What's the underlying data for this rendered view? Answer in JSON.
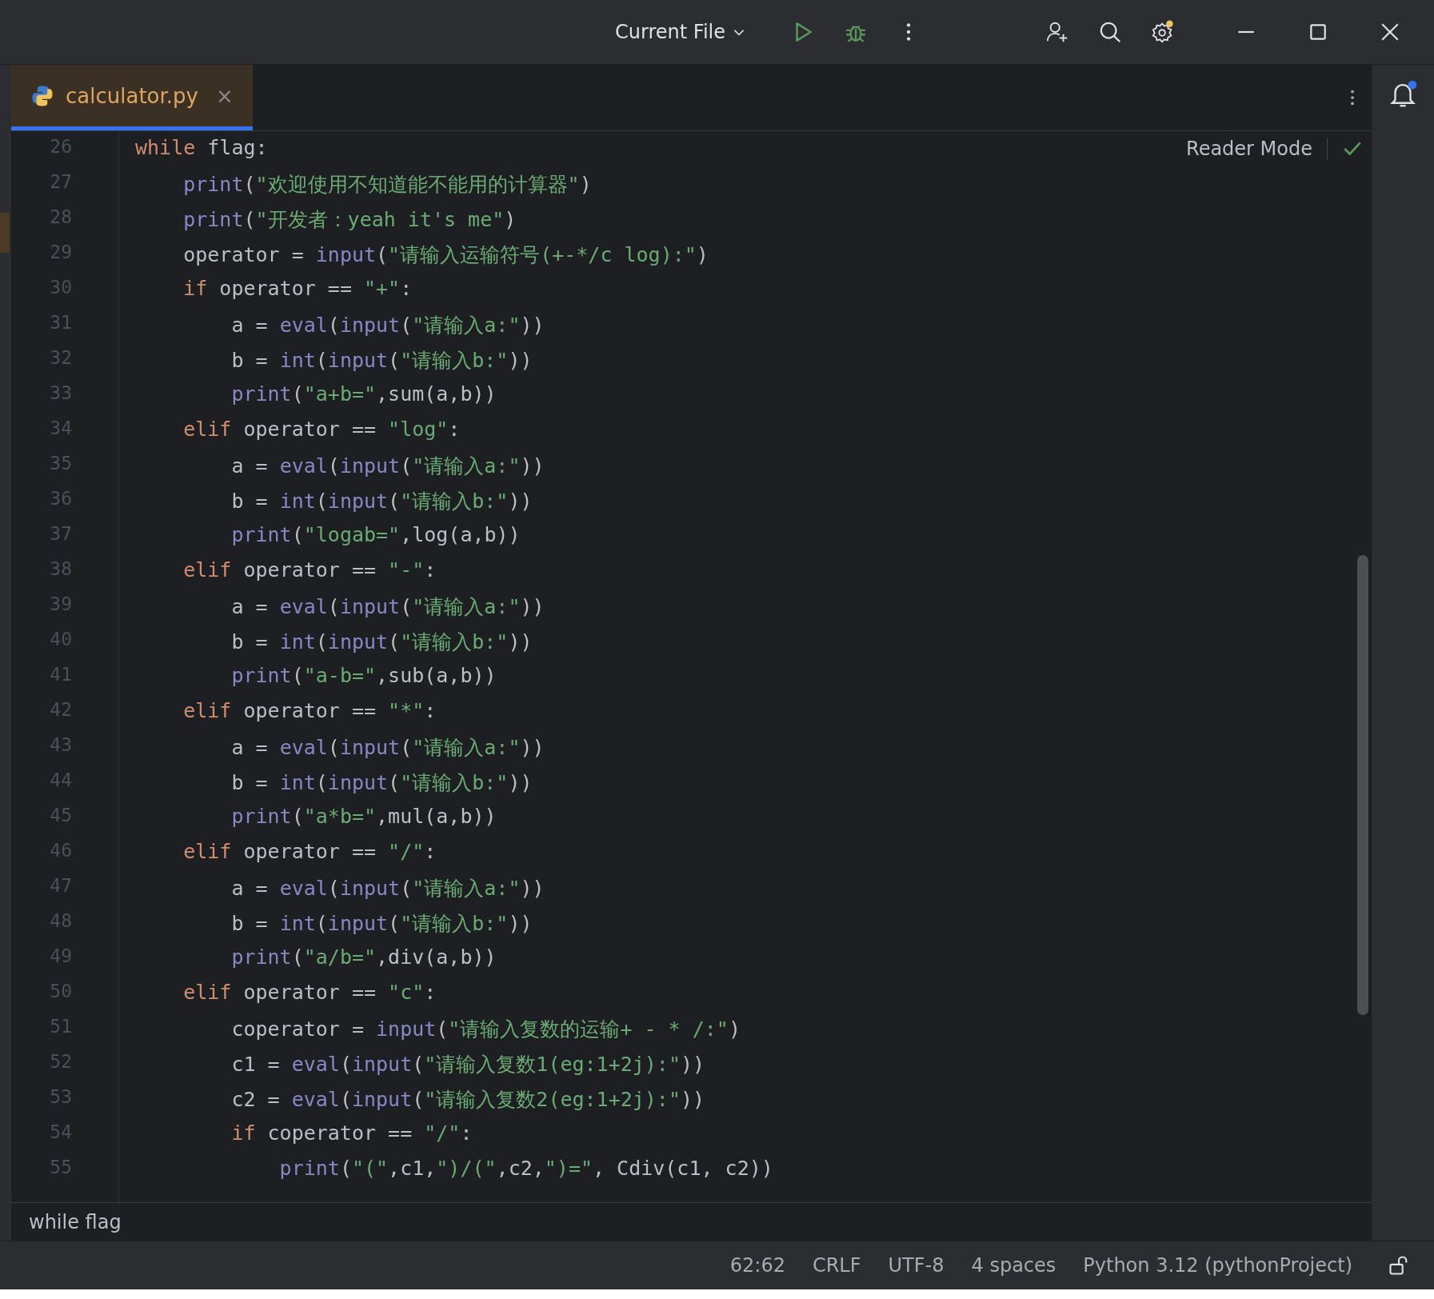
{
  "toolbar": {
    "run_configuration": "Current File"
  },
  "tabs": [
    {
      "label": "calculator.py",
      "selected": true,
      "close": "×"
    }
  ],
  "reader_mode": {
    "label": "Reader Mode"
  },
  "code_lines": [
    {
      "number": "26",
      "tokens": [
        {
          "kind": "kw",
          "text": "while"
        },
        {
          "kind": "plain",
          "text": " flag:"
        }
      ],
      "children": [
        {
          "number": "27",
          "tokens": [
            {
              "kind": "fn",
              "text": "print"
            },
            {
              "kind": "plain",
              "text": "("
            },
            {
              "kind": "str",
              "text": "\"欢迎使用不知道能不能用的计算器\""
            },
            {
              "kind": "plain",
              "text": ")"
            }
          ]
        },
        {
          "number": "28",
          "tokens": [
            {
              "kind": "fn",
              "text": "print"
            },
            {
              "kind": "plain",
              "text": "("
            },
            {
              "kind": "str",
              "text": "\"开发者：yeah it's me\""
            },
            {
              "kind": "plain",
              "text": ")"
            }
          ]
        },
        {
          "number": "29",
          "tokens": [
            {
              "kind": "plain",
              "text": "operator = "
            },
            {
              "kind": "fn",
              "text": "input"
            },
            {
              "kind": "plain",
              "text": "("
            },
            {
              "kind": "str",
              "text": "\"请输入运输符号(+-*/c log):\""
            },
            {
              "kind": "plain",
              "text": ")"
            }
          ]
        },
        {
          "number": "30",
          "tokens": [
            {
              "kind": "kw",
              "text": "if"
            },
            {
              "kind": "plain",
              "text": " operator == "
            },
            {
              "kind": "str",
              "text": "\"+\""
            },
            {
              "kind": "plain",
              "text": ":"
            }
          ],
          "children": [
            {
              "number": "31",
              "tokens": [
                {
                  "kind": "plain",
                  "text": "a = "
                },
                {
                  "kind": "fn",
                  "text": "eval"
                },
                {
                  "kind": "plain",
                  "text": "("
                },
                {
                  "kind": "fn",
                  "text": "input"
                },
                {
                  "kind": "plain",
                  "text": "("
                },
                {
                  "kind": "str",
                  "text": "\"请输入a:\""
                },
                {
                  "kind": "plain",
                  "text": "))"
                }
              ]
            },
            {
              "number": "32",
              "tokens": [
                {
                  "kind": "plain",
                  "text": "b = "
                },
                {
                  "kind": "fn",
                  "text": "int"
                },
                {
                  "kind": "plain",
                  "text": "("
                },
                {
                  "kind": "fn",
                  "text": "input"
                },
                {
                  "kind": "plain",
                  "text": "("
                },
                {
                  "kind": "str",
                  "text": "\"请输入b:\""
                },
                {
                  "kind": "plain",
                  "text": "))"
                }
              ]
            },
            {
              "number": "33",
              "tokens": [
                {
                  "kind": "fn",
                  "text": "print"
                },
                {
                  "kind": "plain",
                  "text": "("
                },
                {
                  "kind": "str",
                  "text": "\"a+b=\""
                },
                {
                  "kind": "plain",
                  "text": ",sum(a,b))"
                }
              ]
            }
          ]
        },
        {
          "number": "34",
          "tokens": [
            {
              "kind": "kw",
              "text": "elif"
            },
            {
              "kind": "plain",
              "text": " operator == "
            },
            {
              "kind": "str",
              "text": "\"log\""
            },
            {
              "kind": "plain",
              "text": ":"
            }
          ],
          "children": [
            {
              "number": "35",
              "tokens": [
                {
                  "kind": "plain",
                  "text": "a = "
                },
                {
                  "kind": "fn",
                  "text": "eval"
                },
                {
                  "kind": "plain",
                  "text": "("
                },
                {
                  "kind": "fn",
                  "text": "input"
                },
                {
                  "kind": "plain",
                  "text": "("
                },
                {
                  "kind": "str",
                  "text": "\"请输入a:\""
                },
                {
                  "kind": "plain",
                  "text": "))"
                }
              ]
            },
            {
              "number": "36",
              "tokens": [
                {
                  "kind": "plain",
                  "text": "b = "
                },
                {
                  "kind": "fn",
                  "text": "int"
                },
                {
                  "kind": "plain",
                  "text": "("
                },
                {
                  "kind": "fn",
                  "text": "input"
                },
                {
                  "kind": "plain",
                  "text": "("
                },
                {
                  "kind": "str",
                  "text": "\"请输入b:\""
                },
                {
                  "kind": "plain",
                  "text": "))"
                }
              ]
            },
            {
              "number": "37",
              "tokens": [
                {
                  "kind": "fn",
                  "text": "print"
                },
                {
                  "kind": "plain",
                  "text": "("
                },
                {
                  "kind": "str",
                  "text": "\"logab=\""
                },
                {
                  "kind": "plain",
                  "text": ",log(a,b))"
                }
              ]
            }
          ]
        },
        {
          "number": "38",
          "tokens": [
            {
              "kind": "kw",
              "text": "elif"
            },
            {
              "kind": "plain",
              "text": " operator == "
            },
            {
              "kind": "str",
              "text": "\"-\""
            },
            {
              "kind": "plain",
              "text": ":"
            }
          ],
          "children": [
            {
              "number": "39",
              "tokens": [
                {
                  "kind": "plain",
                  "text": "a = "
                },
                {
                  "kind": "fn",
                  "text": "eval"
                },
                {
                  "kind": "plain",
                  "text": "("
                },
                {
                  "kind": "fn",
                  "text": "input"
                },
                {
                  "kind": "plain",
                  "text": "("
                },
                {
                  "kind": "str",
                  "text": "\"请输入a:\""
                },
                {
                  "kind": "plain",
                  "text": "))"
                }
              ]
            },
            {
              "number": "40",
              "tokens": [
                {
                  "kind": "plain",
                  "text": "b = "
                },
                {
                  "kind": "fn",
                  "text": "int"
                },
                {
                  "kind": "plain",
                  "text": "("
                },
                {
                  "kind": "fn",
                  "text": "input"
                },
                {
                  "kind": "plain",
                  "text": "("
                },
                {
                  "kind": "str",
                  "text": "\"请输入b:\""
                },
                {
                  "kind": "plain",
                  "text": "))"
                }
              ]
            },
            {
              "number": "41",
              "tokens": [
                {
                  "kind": "fn",
                  "text": "print"
                },
                {
                  "kind": "plain",
                  "text": "("
                },
                {
                  "kind": "str",
                  "text": "\"a-b=\""
                },
                {
                  "kind": "plain",
                  "text": ",sub(a,b))"
                }
              ]
            }
          ]
        },
        {
          "number": "42",
          "tokens": [
            {
              "kind": "kw",
              "text": "elif"
            },
            {
              "kind": "plain",
              "text": " operator == "
            },
            {
              "kind": "str",
              "text": "\"*\""
            },
            {
              "kind": "plain",
              "text": ":"
            }
          ],
          "children": [
            {
              "number": "43",
              "tokens": [
                {
                  "kind": "plain",
                  "text": "a = "
                },
                {
                  "kind": "fn",
                  "text": "eval"
                },
                {
                  "kind": "plain",
                  "text": "("
                },
                {
                  "kind": "fn",
                  "text": "input"
                },
                {
                  "kind": "plain",
                  "text": "("
                },
                {
                  "kind": "str",
                  "text": "\"请输入a:\""
                },
                {
                  "kind": "plain",
                  "text": "))"
                }
              ]
            },
            {
              "number": "44",
              "tokens": [
                {
                  "kind": "plain",
                  "text": "b = "
                },
                {
                  "kind": "fn",
                  "text": "int"
                },
                {
                  "kind": "plain",
                  "text": "("
                },
                {
                  "kind": "fn",
                  "text": "input"
                },
                {
                  "kind": "plain",
                  "text": "("
                },
                {
                  "kind": "str",
                  "text": "\"请输入b:\""
                },
                {
                  "kind": "plain",
                  "text": "))"
                }
              ]
            },
            {
              "number": "45",
              "tokens": [
                {
                  "kind": "fn",
                  "text": "print"
                },
                {
                  "kind": "plain",
                  "text": "("
                },
                {
                  "kind": "str",
                  "text": "\"a*b=\""
                },
                {
                  "kind": "plain",
                  "text": ",mul(a,b))"
                }
              ]
            }
          ]
        },
        {
          "number": "46",
          "tokens": [
            {
              "kind": "kw",
              "text": "elif"
            },
            {
              "kind": "plain",
              "text": " operator == "
            },
            {
              "kind": "str",
              "text": "\"/\""
            },
            {
              "kind": "plain",
              "text": ":"
            }
          ],
          "children": [
            {
              "number": "47",
              "tokens": [
                {
                  "kind": "plain",
                  "text": "a = "
                },
                {
                  "kind": "fn",
                  "text": "eval"
                },
                {
                  "kind": "plain",
                  "text": "("
                },
                {
                  "kind": "fn",
                  "text": "input"
                },
                {
                  "kind": "plain",
                  "text": "("
                },
                {
                  "kind": "str",
                  "text": "\"请输入a:\""
                },
                {
                  "kind": "plain",
                  "text": "))"
                }
              ]
            },
            {
              "number": "48",
              "tokens": [
                {
                  "kind": "plain",
                  "text": "b = "
                },
                {
                  "kind": "fn",
                  "text": "int"
                },
                {
                  "kind": "plain",
                  "text": "("
                },
                {
                  "kind": "fn",
                  "text": "input"
                },
                {
                  "kind": "plain",
                  "text": "("
                },
                {
                  "kind": "str",
                  "text": "\"请输入b:\""
                },
                {
                  "kind": "plain",
                  "text": "))"
                }
              ]
            },
            {
              "number": "49",
              "tokens": [
                {
                  "kind": "fn",
                  "text": "print"
                },
                {
                  "kind": "plain",
                  "text": "("
                },
                {
                  "kind": "str",
                  "text": "\"a/b=\""
                },
                {
                  "kind": "plain",
                  "text": ",div(a,b))"
                }
              ]
            }
          ]
        },
        {
          "number": "50",
          "tokens": [
            {
              "kind": "kw",
              "text": "elif"
            },
            {
              "kind": "plain",
              "text": " operator == "
            },
            {
              "kind": "str",
              "text": "\"c\""
            },
            {
              "kind": "plain",
              "text": ":"
            }
          ],
          "children": [
            {
              "number": "51",
              "tokens": [
                {
                  "kind": "plain",
                  "text": "coperator = "
                },
                {
                  "kind": "fn",
                  "text": "input"
                },
                {
                  "kind": "plain",
                  "text": "("
                },
                {
                  "kind": "str",
                  "text": "\"请输入复数的运输+ - * /:\""
                },
                {
                  "kind": "plain",
                  "text": ")"
                }
              ]
            },
            {
              "number": "52",
              "tokens": [
                {
                  "kind": "plain",
                  "text": "c1 = "
                },
                {
                  "kind": "fn",
                  "text": "eval"
                },
                {
                  "kind": "plain",
                  "text": "("
                },
                {
                  "kind": "fn",
                  "text": "input"
                },
                {
                  "kind": "plain",
                  "text": "("
                },
                {
                  "kind": "str",
                  "text": "\"请输入复数1(eg:1+2j):\""
                },
                {
                  "kind": "plain",
                  "text": "))"
                }
              ]
            },
            {
              "number": "53",
              "tokens": [
                {
                  "kind": "plain",
                  "text": "c2 = "
                },
                {
                  "kind": "fn",
                  "text": "eval"
                },
                {
                  "kind": "plain",
                  "text": "("
                },
                {
                  "kind": "fn",
                  "text": "input"
                },
                {
                  "kind": "plain",
                  "text": "("
                },
                {
                  "kind": "str",
                  "text": "\"请输入复数2(eg:1+2j):\""
                },
                {
                  "kind": "plain",
                  "text": "))"
                }
              ]
            },
            {
              "number": "54",
              "tokens": [
                {
                  "kind": "kw",
                  "text": "if"
                },
                {
                  "kind": "plain",
                  "text": " coperator == "
                },
                {
                  "kind": "str",
                  "text": "\"/\""
                },
                {
                  "kind": "plain",
                  "text": ":"
                }
              ],
              "children": [
                {
                  "number": "55",
                  "tokens": [
                    {
                      "kind": "fn",
                      "text": "print"
                    },
                    {
                      "kind": "plain",
                      "text": "("
                    },
                    {
                      "kind": "str",
                      "text": "\"(\""
                    },
                    {
                      "kind": "plain",
                      "text": ",c1,"
                    },
                    {
                      "kind": "str",
                      "text": "\")/(\""
                    },
                    {
                      "kind": "plain",
                      "text": ",c2,"
                    },
                    {
                      "kind": "str",
                      "text": "\")=\""
                    },
                    {
                      "kind": "plain",
                      "text": ", Cdiv(c1, c2))"
                    }
                  ]
                }
              ]
            }
          ]
        }
      ]
    }
  ],
  "breadcrumb": "while flag",
  "status_bar": {
    "position": "62:62",
    "line_separator": "CRLF",
    "encoding": "UTF-8",
    "indent": "4 spaces",
    "interpreter": "Python 3.12 (pythonProject)"
  }
}
